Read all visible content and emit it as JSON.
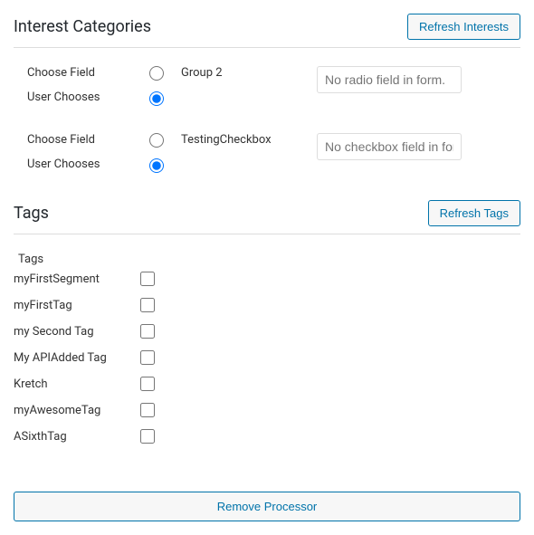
{
  "interest": {
    "title": "Interest Categories",
    "refresh_label": "Refresh Interests",
    "choose_field_label": "Choose Field",
    "user_chooses_label": "User Chooses",
    "groups": [
      {
        "name": "Group 2",
        "placeholder": "No radio field in form."
      },
      {
        "name": "TestingCheckbox",
        "placeholder": "No checkbox field in form."
      }
    ]
  },
  "tags": {
    "title": "Tags",
    "refresh_label": "Refresh Tags",
    "header_label": "Tags",
    "items": [
      "myFirstSegment",
      "myFirstTag",
      "my Second Tag",
      "My APIAdded Tag",
      "Kretch",
      "myAwesomeTag",
      "ASixthTag"
    ]
  },
  "remove_label": "Remove Processor"
}
